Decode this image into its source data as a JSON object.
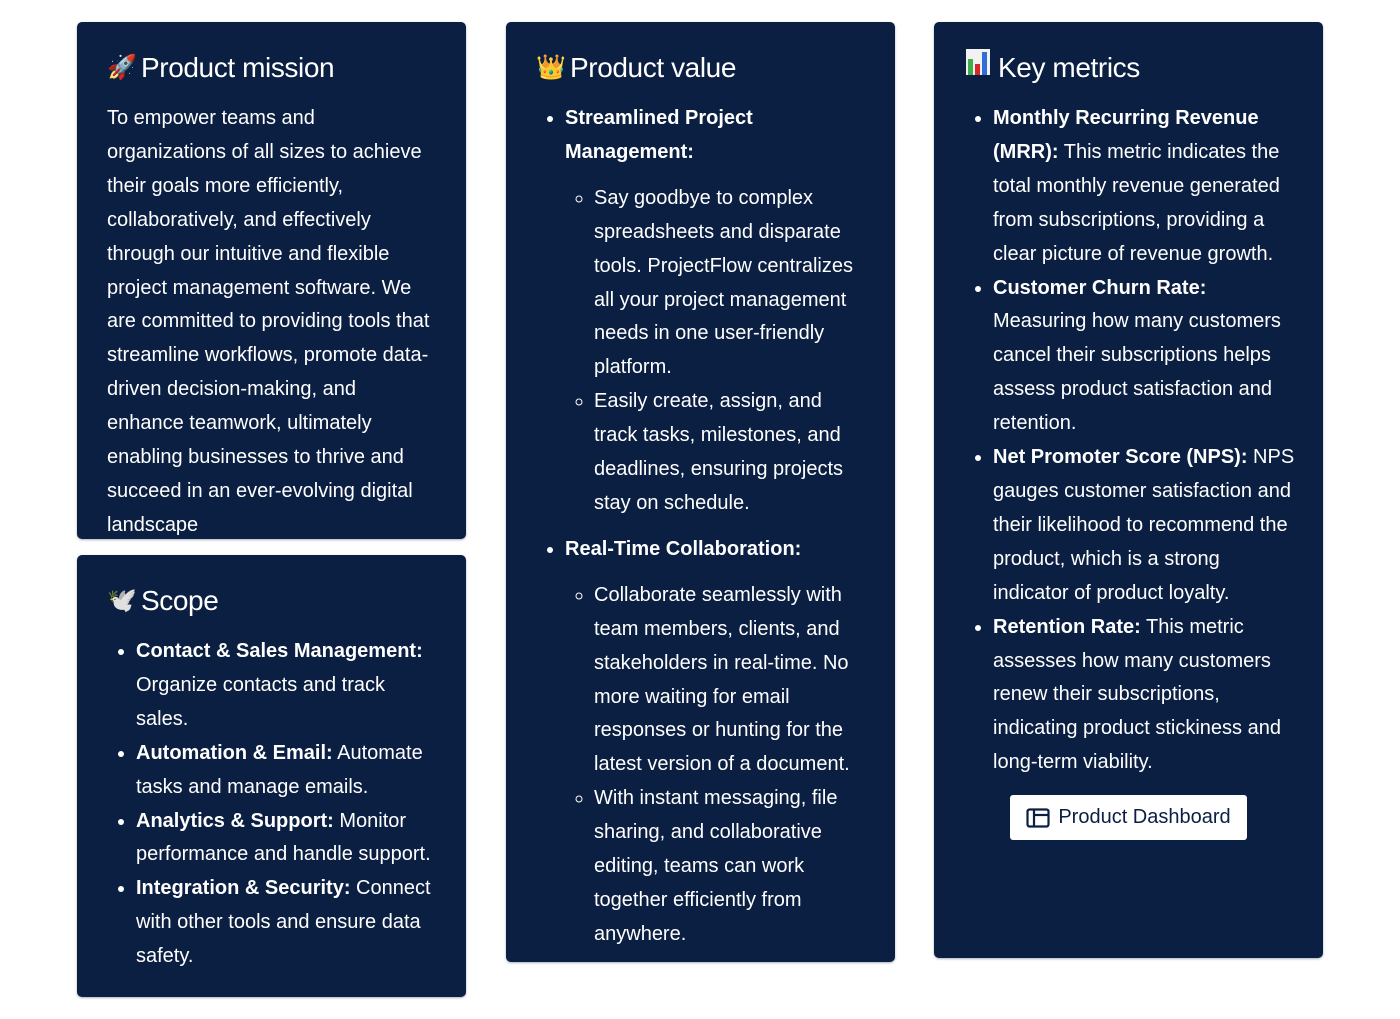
{
  "mission": {
    "icon": "rocket-icon",
    "emoji": "🚀",
    "title": "Product mission",
    "text": "To empower teams and organizations of all sizes to achieve their goals more efficiently, collaboratively, and effectively through our intuitive and flexible project management software. We are committed to providing tools that streamline workflows, promote data-driven decision-making, and enhance teamwork, ultimately enabling businesses to thrive and succeed in an ever-evolving digital landscape"
  },
  "scope": {
    "icon": "dove-icon",
    "emoji": "🕊️",
    "title": "Scope",
    "items": [
      {
        "label": "Contact & Sales Management:",
        "text": " Organize contacts and track sales."
      },
      {
        "label": "Automation & Email:",
        "text": " Automate tasks and manage emails."
      },
      {
        "label": "Analytics & Support:",
        "text": " Monitor performance and handle support."
      },
      {
        "label": "Integration & Security:",
        "text": " Connect with other tools and ensure data safety."
      }
    ]
  },
  "value": {
    "icon": "crown-icon",
    "emoji": "👑",
    "title": "Product value",
    "items": [
      {
        "label": "Streamlined Project Management:",
        "subitems": [
          "Say goodbye to complex spreadsheets and disparate tools. ProjectFlow centralizes all your project management needs in one user-friendly platform.",
          "Easily create, assign, and track tasks, milestones, and deadlines, ensuring projects stay on schedule."
        ]
      },
      {
        "label": "Real-Time Collaboration:",
        "subitems": [
          "Collaborate seamlessly with team members, clients, and stakeholders in real-time. No more waiting for email responses or hunting for the latest version of a document.",
          "With instant messaging, file sharing, and collaborative editing, teams can work together efficiently from anywhere."
        ]
      }
    ]
  },
  "metrics": {
    "icon": "bar-chart-icon",
    "emoji": "📊",
    "title": "Key metrics",
    "items": [
      {
        "label": "Monthly Recurring Revenue (MRR):",
        "text": " This metric indicates the total monthly revenue generated from subscriptions, providing a clear picture of revenue growth."
      },
      {
        "label": "Customer Churn Rate:",
        "text": " Measuring how many customers cancel their subscriptions helps assess product satisfaction and retention."
      },
      {
        "label": "Net Promoter Score (NPS):",
        "text": " NPS gauges customer satisfaction and their likelihood to recommend the product, which is a strong indicator of product loyalty."
      },
      {
        "label": "Retention Rate:",
        "text": " This metric assesses how many customers renew their subscriptions, indicating product stickiness and long-term viability."
      }
    ],
    "button": {
      "label": "Product Dashboard",
      "icon": "dashboard-layout-icon"
    }
  },
  "colors": {
    "card_bg": "#0b1f42",
    "text": "#ffffff",
    "button_bg": "#ffffff",
    "button_text": "#0b1f42"
  }
}
